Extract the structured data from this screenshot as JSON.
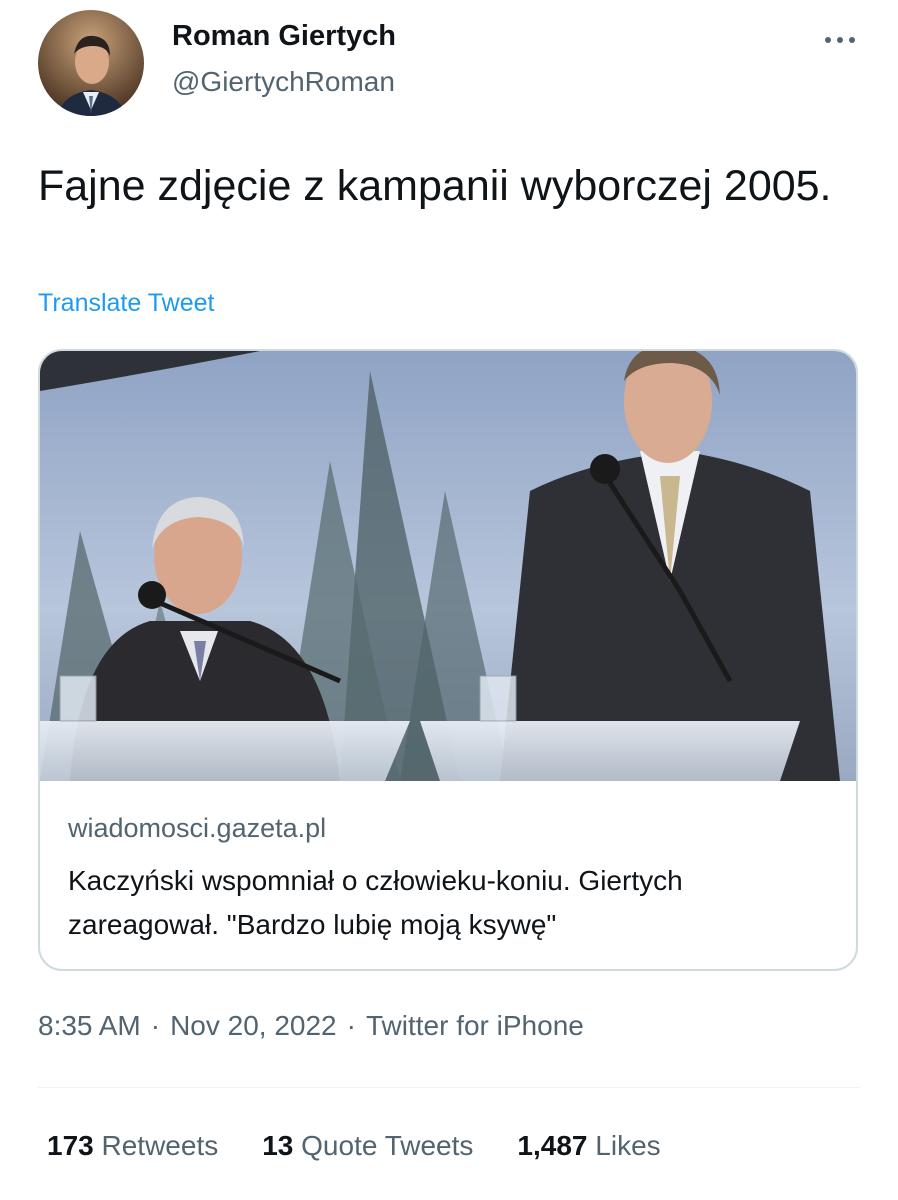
{
  "author": {
    "name": "Roman Giertych",
    "handle": "@GiertychRoman",
    "avatar_icon": "avatar-photo"
  },
  "more_icon": "more-horizontal-icon",
  "tweet": {
    "text": "Fajne zdjęcie z kampanii wyborczej 2005.",
    "translate_label": "Translate Tweet"
  },
  "card": {
    "image_icon": "press-photo",
    "domain": "wiadomosci.gazeta.pl",
    "title": "Kaczyński wspomniał o człowieku-koniu. Giertych zareagował. \"Bardzo lubię moją ksywę\""
  },
  "meta": {
    "time": "8:35 AM",
    "separator": "·",
    "date": "Nov 20, 2022",
    "source": "Twitter for iPhone"
  },
  "stats": {
    "retweets_count": "173",
    "retweets_label": "Retweets",
    "quotes_count": "13",
    "quotes_label": "Quote Tweets",
    "likes_count": "1,487",
    "likes_label": "Likes"
  },
  "colors": {
    "text": "#0f1419",
    "secondary": "#536471",
    "link": "#1d9bf0",
    "border": "#cfd9de"
  }
}
